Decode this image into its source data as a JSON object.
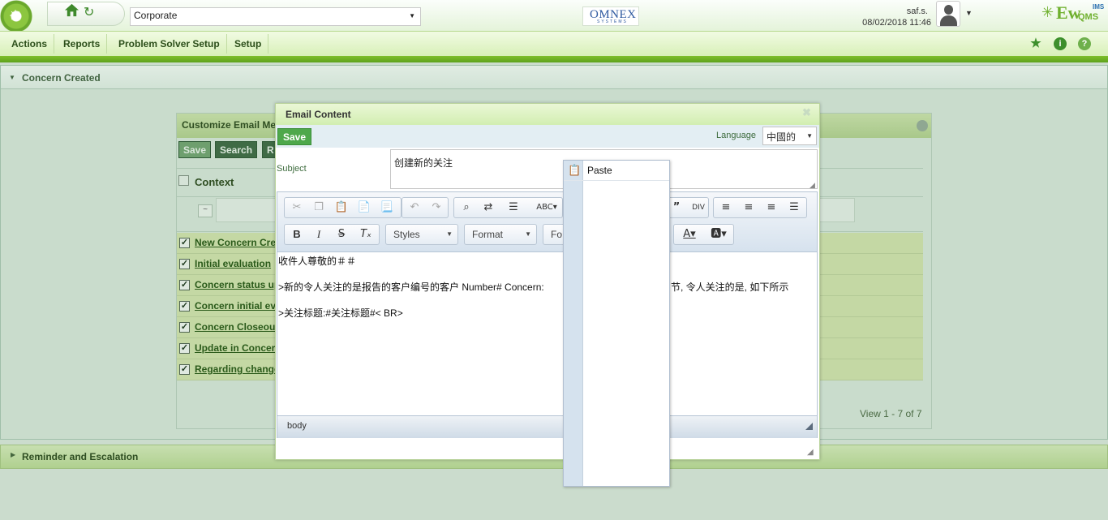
{
  "header": {
    "company": "Corporate",
    "omnex_logo": "OMNEX",
    "omnex_sub": "SYSTEMS",
    "user": "saf.s.",
    "datetime": "08/02/2018 11:46",
    "ewqms_logo": {
      "ew": "Ew",
      "qms": "QMS",
      "ims": "IMS"
    }
  },
  "menu": {
    "items": [
      "Actions",
      "Reports",
      "Problem Solver Setup",
      "Setup"
    ]
  },
  "concern_panel": {
    "title": "Concern Created"
  },
  "grid": {
    "title": "Customize Email Me",
    "buttons": {
      "save": "Save",
      "search": "Search",
      "r": "R"
    },
    "column_context": "Context",
    "rows": [
      "New Concern Crea",
      "Initial evaluation",
      "Concern status up",
      "Concern initial eva",
      "Concern Closeout",
      "Update in Concern",
      "Regarding change"
    ],
    "view_count": "View 1 - 7 of 7"
  },
  "reminder_panel": {
    "title": "Reminder and Escalation"
  },
  "dialog": {
    "title": "Email Content",
    "save": "Save",
    "language_label": "Language",
    "language_value": "中國的",
    "subject_label": "Subject",
    "subject_value": "创建新的关注",
    "editor": {
      "styles": "Styles",
      "format": "Format",
      "font_partial": "Fo",
      "lines": [
        "收件人尊敬的＃＃",
        ">新的令人关注的是报告的客户编号的客户 Number# Concern:",
        "节, 令人关注的是, 如下所示",
        ">关注标题:#关注标题#< BR>"
      ],
      "path": "body"
    }
  },
  "context_menu": {
    "paste": "Paste"
  },
  "colors": {
    "accent_green": "#6fb02e",
    "save_green": "#4ea84b",
    "brand_blue": "#2f5aa0"
  }
}
